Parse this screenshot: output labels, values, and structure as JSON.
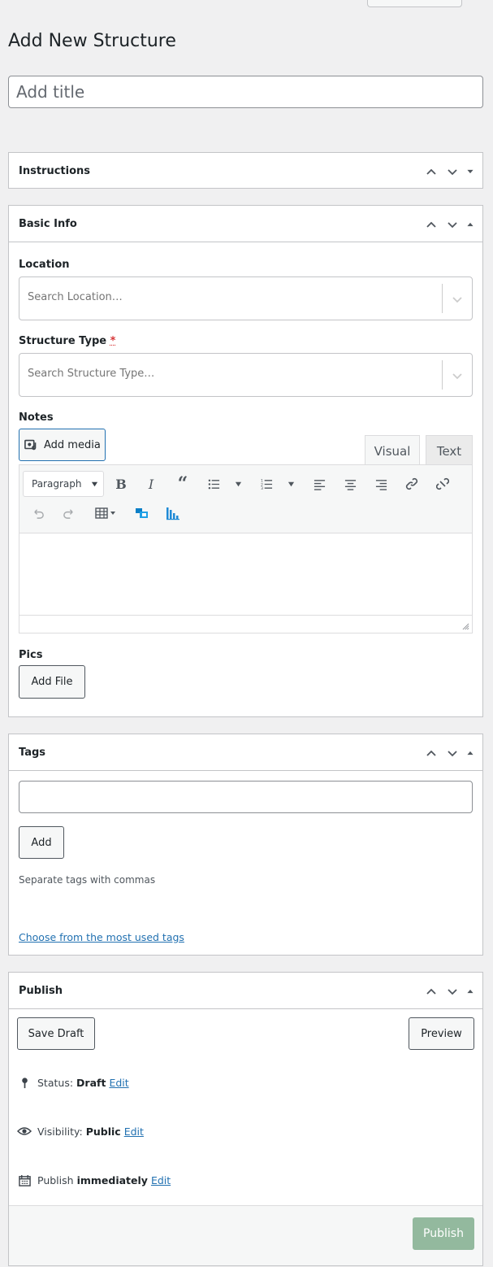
{
  "page": {
    "title": "Add New Structure"
  },
  "title_input": {
    "placeholder": "Add title"
  },
  "boxes": {
    "instructions": {
      "title": "Instructions"
    },
    "basic_info": {
      "title": "Basic Info",
      "location_label": "Location",
      "location_placeholder": "Search Location…",
      "structure_type_label": "Structure Type",
      "structure_type_required": "*",
      "structure_type_placeholder": "Search Structure Type…",
      "notes_label": "Notes",
      "add_media": "Add media",
      "tab_visual": "Visual",
      "tab_text": "Text",
      "format_select": "Paragraph",
      "pics_label": "Pics",
      "add_file": "Add File"
    },
    "tags": {
      "title": "Tags",
      "add_button": "Add",
      "hint": "Separate tags with commas",
      "most_used_link": "Choose from the most used tags"
    },
    "publish": {
      "title": "Publish",
      "save_draft": "Save Draft",
      "preview": "Preview",
      "status_label": "Status:",
      "status_value": "Draft",
      "visibility_label": "Visibility:",
      "visibility_value": "Public",
      "publish_label": "Publish",
      "publish_value": "immediately",
      "edit_link": "Edit",
      "publish_button": "Publish"
    }
  },
  "colors": {
    "accent": "#2271b1",
    "publish_disabled": "#93b99e",
    "required": "#d63638"
  },
  "icons": [
    "chevron-up-icon",
    "chevron-down-icon",
    "triangle-toggle-icon",
    "media-icon",
    "bold-icon",
    "italic-icon",
    "quote-icon",
    "bullet-list-icon",
    "numbered-list-icon",
    "align-left-icon",
    "align-center-icon",
    "align-right-icon",
    "link-icon",
    "unlink-icon",
    "undo-icon",
    "redo-icon",
    "table-icon",
    "pin-icon",
    "eye-icon",
    "calendar-icon"
  ]
}
